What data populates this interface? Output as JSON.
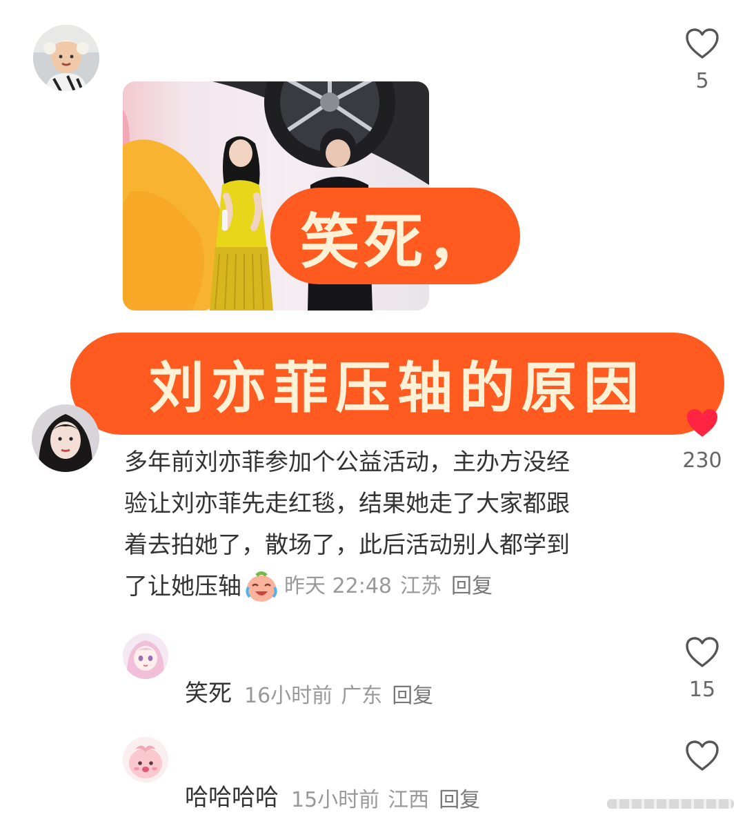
{
  "comments": [
    {
      "like_count": "5",
      "image_alt": "photo reply",
      "avatar": "user-avatar-child"
    },
    {
      "like_count": "230",
      "text": "多年前刘亦菲参加个公益活动，主办方没经验让刘亦菲先走红毯，结果她走了大家都跟着去拍她了，散场了，此后活动别人都学到了让她压轴",
      "text_lines": [
        "多年前刘亦菲参加个公益活动，主办方没经",
        "验让刘亦菲先走红毯，结果她走了大家都跟",
        "着去拍她了，散场了，此后活动别人都学到",
        "了让她压轴"
      ],
      "emoji": "crying-laughing-peach-emoji",
      "time": "昨天 22:48",
      "location": "江苏",
      "reply": "回复"
    }
  ],
  "replies": [
    {
      "text": "笑死",
      "time": "16小时前",
      "location": "广东",
      "reply": "回复",
      "like_count": "15"
    },
    {
      "text": "哈哈哈哈",
      "time": "15小时前",
      "location": "江西",
      "reply": "回复",
      "like_count": ""
    }
  ],
  "banners": {
    "top": "笑死，",
    "bottom": "刘亦菲压轴的原因"
  },
  "colors": {
    "banner_bg": "#ff5a1f",
    "banner_text": "#fff1d6",
    "heart_red": "#ff2442"
  }
}
